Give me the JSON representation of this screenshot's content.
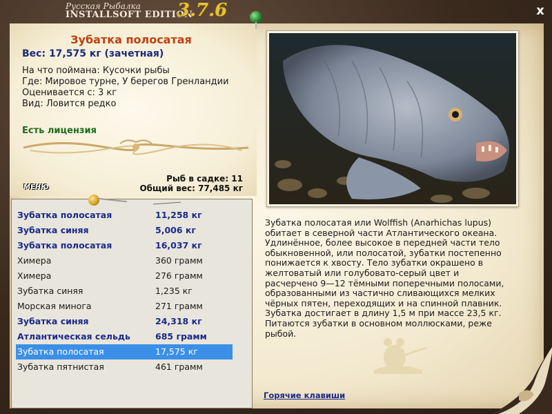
{
  "app": {
    "title_top": "Русская Рыбалка",
    "title_main": "INSTALLSOFT EDITION",
    "version": "3.7.6",
    "close_label": "x"
  },
  "catch": {
    "name": "Зубатка полосатая",
    "weight": "Вес: 17,575 кг (зачетная)",
    "bait": "На что поймана: Кусочки рыбы",
    "place": "Где: Мировое турне, У берегов Гренландии",
    "rated": "Оценивается с: 3 кг",
    "kind": "Вид: Ловится редко",
    "license": "Есть лицензия"
  },
  "cage": {
    "count": "Рыб в садке: 11",
    "total": "Общий вес: 77,485 кг"
  },
  "menu_label": "МЕНЮ",
  "fish_list": [
    {
      "name": "Зубатка полосатая",
      "weight": "11,258 кг",
      "bold": true
    },
    {
      "name": "Зубатка синяя",
      "weight": "5,006 кг",
      "bold": true
    },
    {
      "name": "Зубатка полосатая",
      "weight": "16,037 кг",
      "bold": true
    },
    {
      "name": "Химера",
      "weight": "360 грамм",
      "bold": false
    },
    {
      "name": "Химера",
      "weight": "276 грамм",
      "bold": false
    },
    {
      "name": "Зубатка синяя",
      "weight": "1,235 кг",
      "bold": false
    },
    {
      "name": "Морская минога",
      "weight": "271 грамм",
      "bold": false
    },
    {
      "name": "Зубатка синяя",
      "weight": "24,318 кг",
      "bold": true
    },
    {
      "name": "Атлантическая сельдь",
      "weight": "685 грамм",
      "bold": true
    },
    {
      "name": "Зубатка полосатая",
      "weight": "17,575 кг",
      "bold": false,
      "selected": true
    },
    {
      "name": "Зубатка пятнистая",
      "weight": "461 грамм",
      "bold": false
    }
  ],
  "description": "Зубатка полосатая или Wolffish (Anarhichas lupus) обитает в северной части Атлантического океана. Удлинённое, более высокое в передней части тело обыкновенной, или полосатой, зубатки постепенно понижается к хвосту. Тело зубатки окрашено в желтоватый или голубовато-серый цвет и расчерчено 9—12 тёмными поперечными полосами, образованными из частично сливающихся мелких чёрных пятен, переходящих и на спинной плавник. Зубатка достигает в длину 1,5 м при массе 23,5 кг. Питаются зубатки в основном моллюсками, реже рыбой.",
  "hotkeys_label": "Горячие клавиши",
  "colors": {
    "accent_name": "#c04010",
    "bold_row": "#1b2a8a",
    "selected_row": "#3c8fe6",
    "license": "#1f6a20"
  }
}
